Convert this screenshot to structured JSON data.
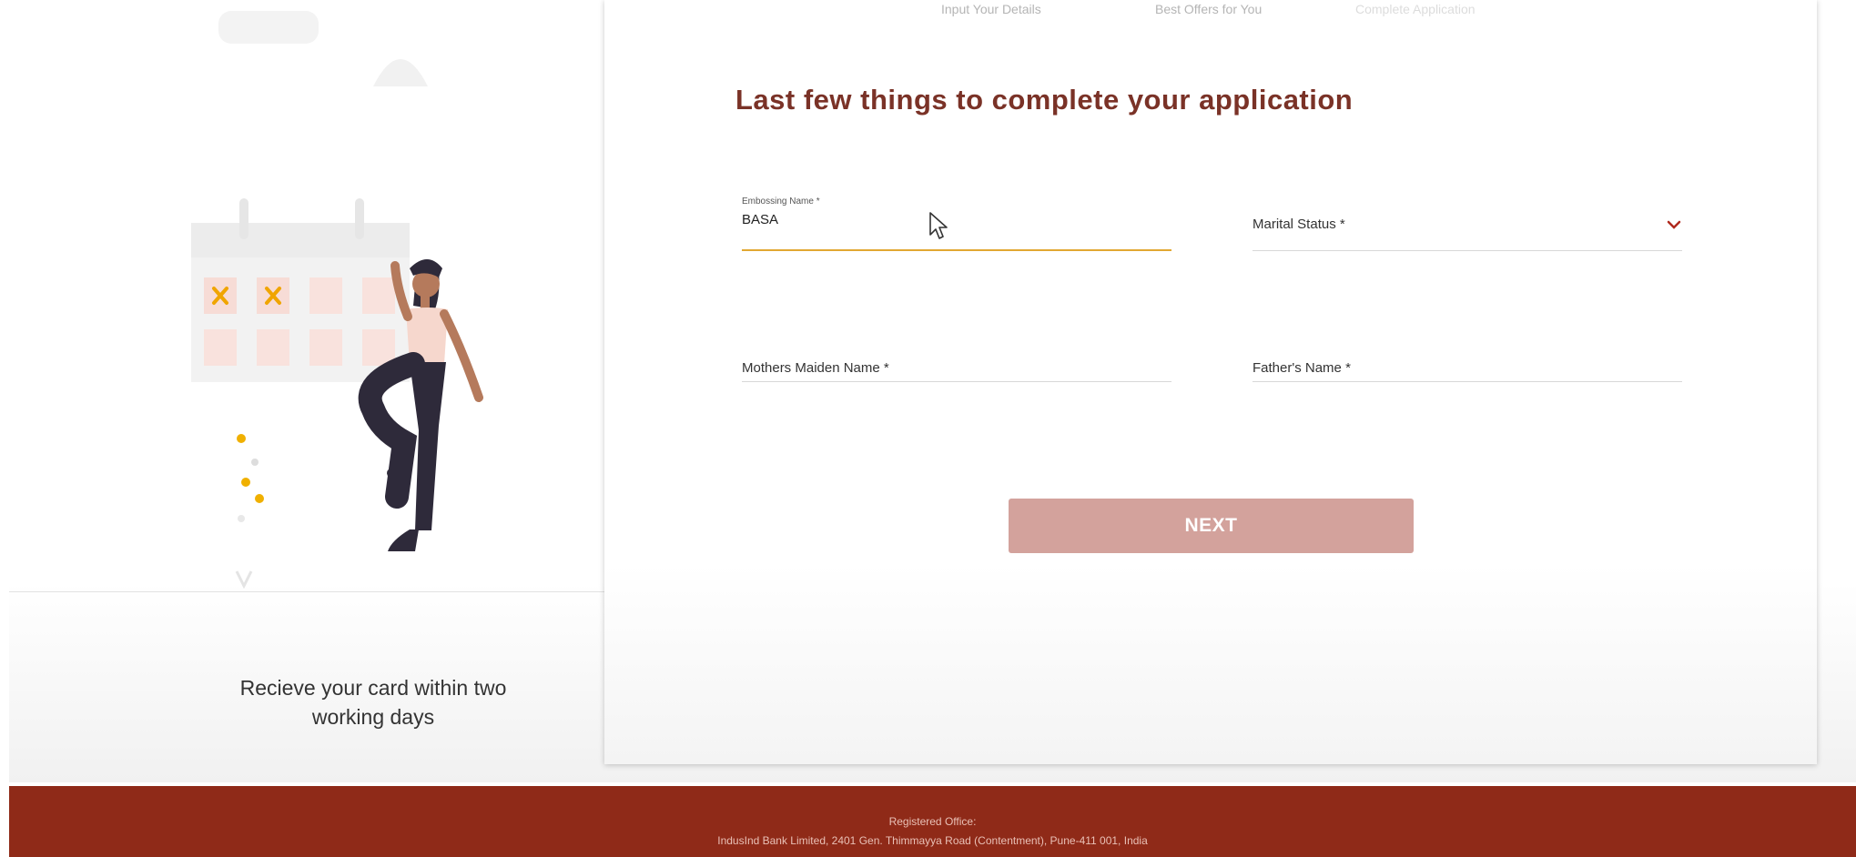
{
  "steps": [
    "Input Your Details",
    "Best Offers for You",
    "Complete Application"
  ],
  "form": {
    "title": "Last few things to complete your application",
    "embossing_name": {
      "small_label": "Embossing Name *",
      "value": "BASA"
    },
    "marital_status": {
      "label": "Marital Status *"
    },
    "mothers_maiden_name": {
      "label": "Mothers Maiden Name *"
    },
    "fathers_name": {
      "label": "Father's Name *"
    },
    "next_label": "NEXT"
  },
  "left_panel": {
    "caption_line1": "Recieve your card within two",
    "caption_line2": "working days"
  },
  "footer": {
    "line1": "Registered Office:",
    "line2": "IndusInd Bank Limited, 2401 Gen. Thimmayya Road (Contentment), Pune-411 001, India"
  },
  "colors": {
    "title": "#7a3227",
    "active_underline": "#e2a832",
    "chevron": "#b02a1e",
    "next_button": "#d3a29c",
    "footer": "#8f2a18"
  },
  "icons": {
    "chevron": "chevron-down-icon",
    "cursor": "mouse-pointer-icon",
    "illustration": "calendar-woman-illustration"
  }
}
